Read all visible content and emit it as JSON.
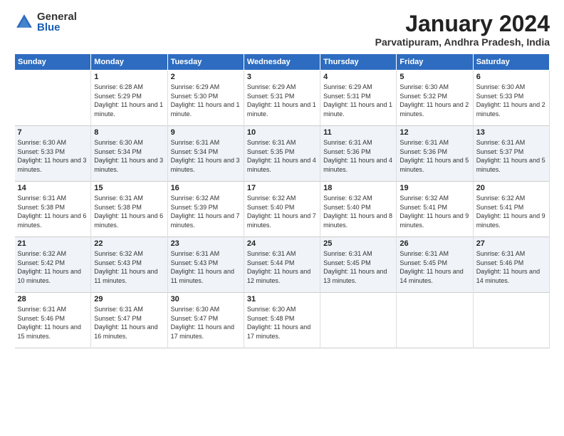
{
  "logo": {
    "general": "General",
    "blue": "Blue"
  },
  "title": "January 2024",
  "location": "Parvatipuram, Andhra Pradesh, India",
  "headers": [
    "Sunday",
    "Monday",
    "Tuesday",
    "Wednesday",
    "Thursday",
    "Friday",
    "Saturday"
  ],
  "weeks": [
    [
      {
        "num": "",
        "sunrise": "",
        "sunset": "",
        "daylight": ""
      },
      {
        "num": "1",
        "sunrise": "Sunrise: 6:28 AM",
        "sunset": "Sunset: 5:29 PM",
        "daylight": "Daylight: 11 hours and 1 minute."
      },
      {
        "num": "2",
        "sunrise": "Sunrise: 6:29 AM",
        "sunset": "Sunset: 5:30 PM",
        "daylight": "Daylight: 11 hours and 1 minute."
      },
      {
        "num": "3",
        "sunrise": "Sunrise: 6:29 AM",
        "sunset": "Sunset: 5:31 PM",
        "daylight": "Daylight: 11 hours and 1 minute."
      },
      {
        "num": "4",
        "sunrise": "Sunrise: 6:29 AM",
        "sunset": "Sunset: 5:31 PM",
        "daylight": "Daylight: 11 hours and 1 minute."
      },
      {
        "num": "5",
        "sunrise": "Sunrise: 6:30 AM",
        "sunset": "Sunset: 5:32 PM",
        "daylight": "Daylight: 11 hours and 2 minutes."
      },
      {
        "num": "6",
        "sunrise": "Sunrise: 6:30 AM",
        "sunset": "Sunset: 5:33 PM",
        "daylight": "Daylight: 11 hours and 2 minutes."
      }
    ],
    [
      {
        "num": "7",
        "sunrise": "Sunrise: 6:30 AM",
        "sunset": "Sunset: 5:33 PM",
        "daylight": "Daylight: 11 hours and 3 minutes."
      },
      {
        "num": "8",
        "sunrise": "Sunrise: 6:30 AM",
        "sunset": "Sunset: 5:34 PM",
        "daylight": "Daylight: 11 hours and 3 minutes."
      },
      {
        "num": "9",
        "sunrise": "Sunrise: 6:31 AM",
        "sunset": "Sunset: 5:34 PM",
        "daylight": "Daylight: 11 hours and 3 minutes."
      },
      {
        "num": "10",
        "sunrise": "Sunrise: 6:31 AM",
        "sunset": "Sunset: 5:35 PM",
        "daylight": "Daylight: 11 hours and 4 minutes."
      },
      {
        "num": "11",
        "sunrise": "Sunrise: 6:31 AM",
        "sunset": "Sunset: 5:36 PM",
        "daylight": "Daylight: 11 hours and 4 minutes."
      },
      {
        "num": "12",
        "sunrise": "Sunrise: 6:31 AM",
        "sunset": "Sunset: 5:36 PM",
        "daylight": "Daylight: 11 hours and 5 minutes."
      },
      {
        "num": "13",
        "sunrise": "Sunrise: 6:31 AM",
        "sunset": "Sunset: 5:37 PM",
        "daylight": "Daylight: 11 hours and 5 minutes."
      }
    ],
    [
      {
        "num": "14",
        "sunrise": "Sunrise: 6:31 AM",
        "sunset": "Sunset: 5:38 PM",
        "daylight": "Daylight: 11 hours and 6 minutes."
      },
      {
        "num": "15",
        "sunrise": "Sunrise: 6:31 AM",
        "sunset": "Sunset: 5:38 PM",
        "daylight": "Daylight: 11 hours and 6 minutes."
      },
      {
        "num": "16",
        "sunrise": "Sunrise: 6:32 AM",
        "sunset": "Sunset: 5:39 PM",
        "daylight": "Daylight: 11 hours and 7 minutes."
      },
      {
        "num": "17",
        "sunrise": "Sunrise: 6:32 AM",
        "sunset": "Sunset: 5:40 PM",
        "daylight": "Daylight: 11 hours and 7 minutes."
      },
      {
        "num": "18",
        "sunrise": "Sunrise: 6:32 AM",
        "sunset": "Sunset: 5:40 PM",
        "daylight": "Daylight: 11 hours and 8 minutes."
      },
      {
        "num": "19",
        "sunrise": "Sunrise: 6:32 AM",
        "sunset": "Sunset: 5:41 PM",
        "daylight": "Daylight: 11 hours and 9 minutes."
      },
      {
        "num": "20",
        "sunrise": "Sunrise: 6:32 AM",
        "sunset": "Sunset: 5:41 PM",
        "daylight": "Daylight: 11 hours and 9 minutes."
      }
    ],
    [
      {
        "num": "21",
        "sunrise": "Sunrise: 6:32 AM",
        "sunset": "Sunset: 5:42 PM",
        "daylight": "Daylight: 11 hours and 10 minutes."
      },
      {
        "num": "22",
        "sunrise": "Sunrise: 6:32 AM",
        "sunset": "Sunset: 5:43 PM",
        "daylight": "Daylight: 11 hours and 11 minutes."
      },
      {
        "num": "23",
        "sunrise": "Sunrise: 6:31 AM",
        "sunset": "Sunset: 5:43 PM",
        "daylight": "Daylight: 11 hours and 11 minutes."
      },
      {
        "num": "24",
        "sunrise": "Sunrise: 6:31 AM",
        "sunset": "Sunset: 5:44 PM",
        "daylight": "Daylight: 11 hours and 12 minutes."
      },
      {
        "num": "25",
        "sunrise": "Sunrise: 6:31 AM",
        "sunset": "Sunset: 5:45 PM",
        "daylight": "Daylight: 11 hours and 13 minutes."
      },
      {
        "num": "26",
        "sunrise": "Sunrise: 6:31 AM",
        "sunset": "Sunset: 5:45 PM",
        "daylight": "Daylight: 11 hours and 14 minutes."
      },
      {
        "num": "27",
        "sunrise": "Sunrise: 6:31 AM",
        "sunset": "Sunset: 5:46 PM",
        "daylight": "Daylight: 11 hours and 14 minutes."
      }
    ],
    [
      {
        "num": "28",
        "sunrise": "Sunrise: 6:31 AM",
        "sunset": "Sunset: 5:46 PM",
        "daylight": "Daylight: 11 hours and 15 minutes."
      },
      {
        "num": "29",
        "sunrise": "Sunrise: 6:31 AM",
        "sunset": "Sunset: 5:47 PM",
        "daylight": "Daylight: 11 hours and 16 minutes."
      },
      {
        "num": "30",
        "sunrise": "Sunrise: 6:30 AM",
        "sunset": "Sunset: 5:47 PM",
        "daylight": "Daylight: 11 hours and 17 minutes."
      },
      {
        "num": "31",
        "sunrise": "Sunrise: 6:30 AM",
        "sunset": "Sunset: 5:48 PM",
        "daylight": "Daylight: 11 hours and 17 minutes."
      },
      {
        "num": "",
        "sunrise": "",
        "sunset": "",
        "daylight": ""
      },
      {
        "num": "",
        "sunrise": "",
        "sunset": "",
        "daylight": ""
      },
      {
        "num": "",
        "sunrise": "",
        "sunset": "",
        "daylight": ""
      }
    ]
  ]
}
